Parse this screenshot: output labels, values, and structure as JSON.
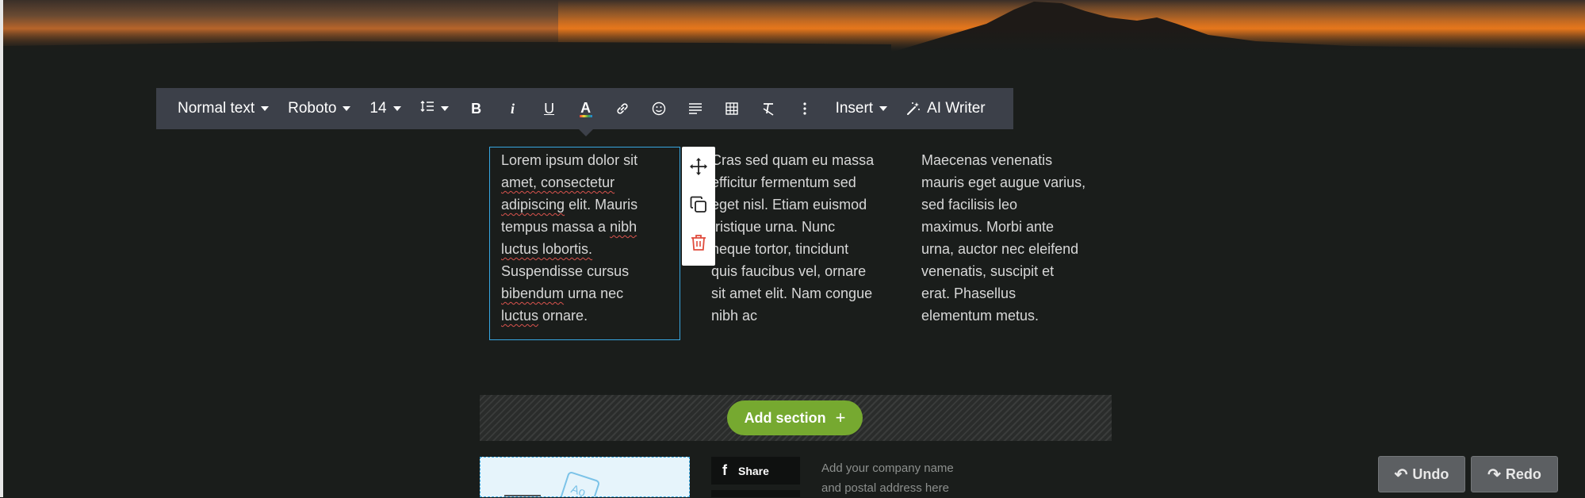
{
  "toolbar": {
    "text_style": "Normal text",
    "font": "Roboto",
    "size": "14",
    "insert_label": "Insert",
    "ai_writer_label": "AI Writer",
    "bold_glyph": "B",
    "italic_glyph": "i",
    "underline_glyph": "U",
    "color_glyph": "A"
  },
  "columns": [
    {
      "lines": [
        [
          {
            "t": "Lorem ipsum dolor sit"
          }
        ],
        [
          {
            "t": "amet, consectetur",
            "spell": true
          }
        ],
        [
          {
            "t": "adipiscing",
            "spell": true
          },
          {
            "t": " elit. Mauris"
          }
        ],
        [
          {
            "t": "tempus massa a "
          },
          {
            "t": "nibh",
            "spell": true
          }
        ],
        [
          {
            "t": "luctus lobortis.",
            "spell": true
          }
        ],
        [
          {
            "t": "Suspendisse cursus"
          }
        ],
        [
          {
            "t": "bibendum",
            "spell": true
          },
          {
            "t": " urna nec"
          }
        ],
        [
          {
            "t": "luctus",
            "spell": true
          },
          {
            "t": " ornare."
          }
        ]
      ]
    },
    {
      "lines": [
        [
          {
            "t": "Cras sed quam eu massa"
          }
        ],
        [
          {
            "t": "efficitur fermentum sed"
          }
        ],
        [
          {
            "t": "eget nisl. Etiam euismod"
          }
        ],
        [
          {
            "t": "tristique urna. Nunc"
          }
        ],
        [
          {
            "t": "neque tortor, tincidunt"
          }
        ],
        [
          {
            "t": "quis faucibus vel, ornare"
          }
        ],
        [
          {
            "t": "sit amet elit. Nam congue"
          }
        ],
        [
          {
            "t": "nibh ac"
          }
        ]
      ]
    },
    {
      "lines": [
        [
          {
            "t": "Maecenas venenatis"
          }
        ],
        [
          {
            "t": "mauris eget augue varius,"
          }
        ],
        [
          {
            "t": "sed facilisis leo"
          }
        ],
        [
          {
            "t": "maximus. Morbi ante"
          }
        ],
        [
          {
            "t": "urna, auctor nec eleifend"
          }
        ],
        [
          {
            "t": "venenatis, suscipit et"
          }
        ],
        [
          {
            "t": "erat. Phasellus"
          }
        ],
        [
          {
            "t": "elementum metus."
          }
        ]
      ]
    }
  ],
  "add_section_label": "Add section",
  "share_label": "Share",
  "company_line1": "Add your company name",
  "company_line2": "and postal address here",
  "undo_label": "Undo",
  "redo_label": "Redo",
  "colors": {
    "accent_green": "#76a930",
    "selection_blue": "#37a6e0",
    "toolbar_bg": "#3c4049",
    "delete_red": "#e04b3c"
  },
  "icons": [
    "move-icon",
    "duplicate-icon",
    "trash-icon",
    "line-height-icon",
    "link-icon",
    "emoji-icon",
    "align-icon",
    "table-icon",
    "clear-format-icon",
    "more-icon",
    "magic-wand-icon",
    "facebook-icon"
  ]
}
